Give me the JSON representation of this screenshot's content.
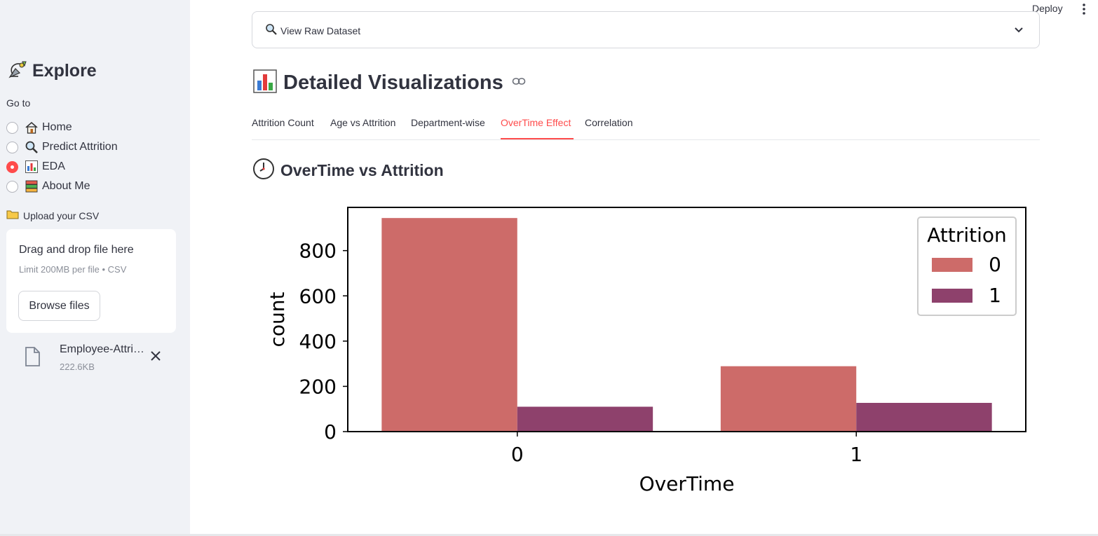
{
  "sidebar": {
    "title": "Explore",
    "goto_label": "Go to",
    "nav": [
      {
        "label": "Home",
        "icon": "house-icon",
        "selected": false
      },
      {
        "label": "Predict Attrition",
        "icon": "magnifier-icon",
        "selected": false
      },
      {
        "label": "EDA",
        "icon": "bar-chart-icon",
        "selected": true
      },
      {
        "label": "About Me",
        "icon": "books-icon",
        "selected": false
      }
    ],
    "upload": {
      "label": "Upload your CSV",
      "drop_text": "Drag and drop file here",
      "limit_text": "Limit 200MB per file • CSV",
      "browse_label": "Browse files",
      "file_name": "Employee-Attrition.csv",
      "file_size": "222.6KB"
    }
  },
  "topbar": {
    "deploy_label": "Deploy"
  },
  "main": {
    "expander_label": "View Raw Dataset",
    "heading": "Detailed Visualizations",
    "tabs": [
      "Attrition Count",
      "Age vs Attrition",
      "Department-wise",
      "OverTime Effect",
      "Correlation"
    ],
    "active_tab": 3,
    "subheading": "OverTime vs Attrition"
  },
  "colors": {
    "accent": "#ff4b4b",
    "series0": "#cd6b69",
    "series1": "#8e416c"
  },
  "chart_data": {
    "type": "bar",
    "categories": [
      "0",
      "1"
    ],
    "series": [
      {
        "name": "0",
        "values": [
          944,
          289
        ]
      },
      {
        "name": "1",
        "values": [
          110,
          127
        ]
      }
    ],
    "xlabel": "OverTime",
    "ylabel": "count",
    "yticks": [
      0,
      200,
      400,
      600,
      800
    ],
    "ylim": [
      0,
      991
    ],
    "legend_title": "Attrition",
    "legend_position": "top-right",
    "grid": false
  }
}
